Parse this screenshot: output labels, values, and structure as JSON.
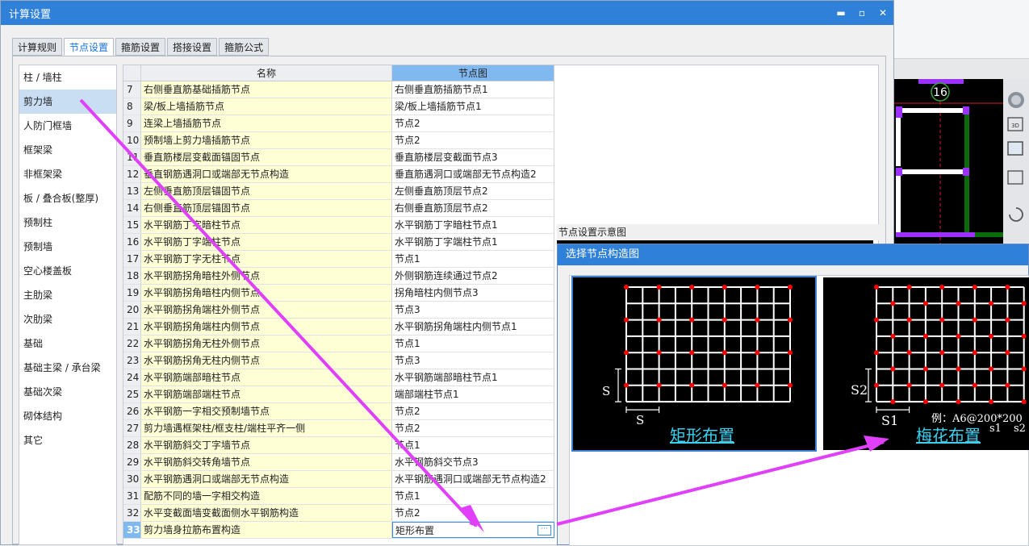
{
  "window": {
    "title": "计算设置",
    "min": "▬",
    "max": "▫",
    "close": "✕"
  },
  "tabs": [
    {
      "label": "计算规则",
      "active": false
    },
    {
      "label": "节点设置",
      "active": true
    },
    {
      "label": "箍筋设置",
      "active": false
    },
    {
      "label": "搭接设置",
      "active": false
    },
    {
      "label": "箍筋公式",
      "active": false
    }
  ],
  "categories": [
    {
      "label": "柱 / 墙柱",
      "selected": false
    },
    {
      "label": "剪力墙",
      "selected": true
    },
    {
      "label": "人防门框墙",
      "selected": false
    },
    {
      "label": "框架梁",
      "selected": false
    },
    {
      "label": "非框架梁",
      "selected": false
    },
    {
      "label": "板 / 叠合板(整厚)",
      "selected": false
    },
    {
      "label": "预制柱",
      "selected": false
    },
    {
      "label": "预制墙",
      "selected": false
    },
    {
      "label": "空心楼盖板",
      "selected": false
    },
    {
      "label": "主肋梁",
      "selected": false
    },
    {
      "label": "次肋梁",
      "selected": false
    },
    {
      "label": "基础",
      "selected": false
    },
    {
      "label": "基础主梁 / 承台梁",
      "selected": false
    },
    {
      "label": "基础次梁",
      "selected": false
    },
    {
      "label": "砌体结构",
      "selected": false
    },
    {
      "label": "其它",
      "selected": false
    }
  ],
  "table": {
    "headers": {
      "name": "名称",
      "node": "节点图"
    },
    "rows": [
      {
        "idx": "7",
        "name": "右侧垂直筋基础插筋节点",
        "node": "右侧垂直筋插筋节点1"
      },
      {
        "idx": "8",
        "name": "梁/板上墙插筋节点",
        "node": "梁/板上墙插筋节点1"
      },
      {
        "idx": "9",
        "name": "连梁上墙插筋节点",
        "node": "节点2"
      },
      {
        "idx": "10",
        "name": "预制墙上剪力墙插筋节点",
        "node": "节点2"
      },
      {
        "idx": "11",
        "name": "垂直筋楼层变截面锚固节点",
        "node": "垂直筋楼层变截面节点3"
      },
      {
        "idx": "12",
        "name": "垂直钢筋遇洞口或端部无节点构造",
        "node": "垂直筋遇洞口或端部无节点构造2"
      },
      {
        "idx": "13",
        "name": "左侧垂直筋顶层锚固节点",
        "node": "左侧垂直筋顶层节点2"
      },
      {
        "idx": "14",
        "name": "右侧垂直筋顶层锚固节点",
        "node": "右侧垂直筋顶层节点2"
      },
      {
        "idx": "15",
        "name": "水平钢筋丁字暗柱节点",
        "node": "水平钢筋丁字暗柱节点1"
      },
      {
        "idx": "16",
        "name": "水平钢筋丁字端柱节点",
        "node": "水平钢筋丁字端柱节点1"
      },
      {
        "idx": "17",
        "name": "水平钢筋丁字无柱节点",
        "node": "节点1"
      },
      {
        "idx": "18",
        "name": "水平钢筋拐角暗柱外侧节点",
        "node": "外侧钢筋连续通过节点2"
      },
      {
        "idx": "19",
        "name": "水平钢筋拐角暗柱内侧节点",
        "node": "拐角暗柱内侧节点3"
      },
      {
        "idx": "20",
        "name": "水平钢筋拐角端柱外侧节点",
        "node": "节点3"
      },
      {
        "idx": "21",
        "name": "水平钢筋拐角端柱内侧节点",
        "node": "水平钢筋拐角端柱内侧节点1"
      },
      {
        "idx": "22",
        "name": "水平钢筋拐角无柱外侧节点",
        "node": "节点1"
      },
      {
        "idx": "23",
        "name": "水平钢筋拐角无柱内侧节点",
        "node": "节点3"
      },
      {
        "idx": "24",
        "name": "水平钢筋端部暗柱节点",
        "node": "水平钢筋端部暗柱节点1"
      },
      {
        "idx": "25",
        "name": "水平钢筋端部端柱节点",
        "node": "端部端柱节点1"
      },
      {
        "idx": "26",
        "name": "水平钢筋一字相交预制墙节点",
        "node": "节点2"
      },
      {
        "idx": "27",
        "name": "剪力墙遇框架柱/框支柱/端柱平齐一侧",
        "node": "节点2"
      },
      {
        "idx": "28",
        "name": "水平钢筋斜交丁字墙节点",
        "node": "节点1"
      },
      {
        "idx": "29",
        "name": "水平钢筋斜交转角墙节点",
        "node": "水平钢筋斜交节点3"
      },
      {
        "idx": "30",
        "name": "水平钢筋遇洞口或端部无节点构造",
        "node": "水平钢筋遇洞口或端部无节点构造2"
      },
      {
        "idx": "31",
        "name": "配筋不同的墙一字相交构造",
        "node": "节点1"
      },
      {
        "idx": "32",
        "name": "水平变截面墙变截面侧水平钢筋构造",
        "node": "节点2"
      },
      {
        "idx": "33",
        "name": "剪力墙身拉筋布置构造",
        "node": "矩形布置",
        "selected": true
      }
    ],
    "ellipsis": "···"
  },
  "preview": {
    "label": "节点设置示意图"
  },
  "dialog": {
    "title": "选择节点构造图",
    "options": [
      {
        "label": "矩形布置",
        "selected": true,
        "dim_v": "S",
        "dim_h": "S"
      },
      {
        "label": "梅花布置",
        "selected": false,
        "dim_v": "S2",
        "dim_h": "S1",
        "example": "例：A6@200*200",
        "s1": "s1",
        "s2": "s2"
      }
    ]
  },
  "cad": {
    "axis_label": "16"
  },
  "colors": {
    "accent": "#2f80d9",
    "header_selected": "#7fb9f0",
    "name_cell": "#ffffd6",
    "arrow": "#e040fb",
    "dot": "#ff0000",
    "option_label": "#3ad0f0"
  }
}
